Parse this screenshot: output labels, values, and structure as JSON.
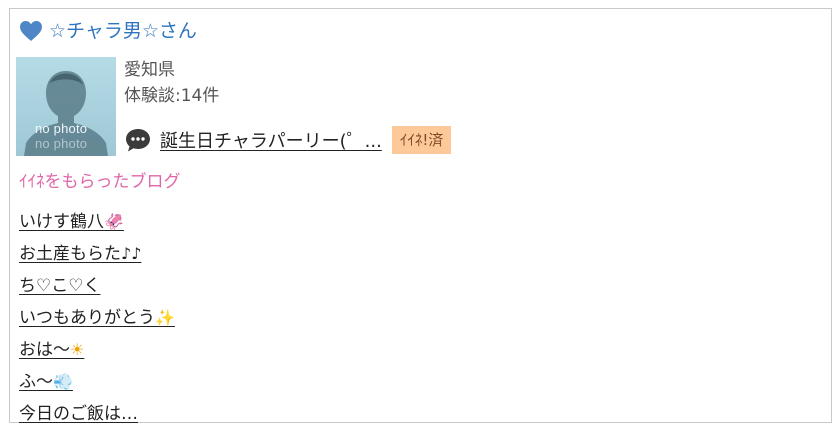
{
  "user": {
    "name": "☆チャラ男☆さん",
    "prefecture": "愛知県",
    "experience_count": "体験談:14件",
    "avatar_label": "no photo",
    "avatar_label_ghost": "no photo"
  },
  "latest_post": {
    "title": "誕生日チャラパーリー(゜...",
    "like_badge": "ｲｲﾈ!済"
  },
  "liked_blogs": {
    "heading": "ｲｲﾈをもらったブログ",
    "items": [
      {
        "text": "いけす鶴八",
        "emoji": "🦑"
      },
      {
        "text": "お土産もらた",
        "emoji": "♪♪"
      },
      {
        "text": "ち♡こ♡く",
        "emoji": ""
      },
      {
        "text": "いつもありがとう",
        "emoji": "✨"
      },
      {
        "text": "おは〜",
        "emoji": "☀"
      },
      {
        "text": "ふ〜",
        "emoji": "💨"
      },
      {
        "text": "今日のご飯は…",
        "emoji": ""
      }
    ]
  },
  "colors": {
    "heart": "#4f86c6",
    "name": "#2f74c0",
    "heading": "#e066a8",
    "badge_bg": "#ffc898"
  },
  "icons": [
    "heart-icon",
    "speech-bubble-icon",
    "no-photo-avatar"
  ]
}
